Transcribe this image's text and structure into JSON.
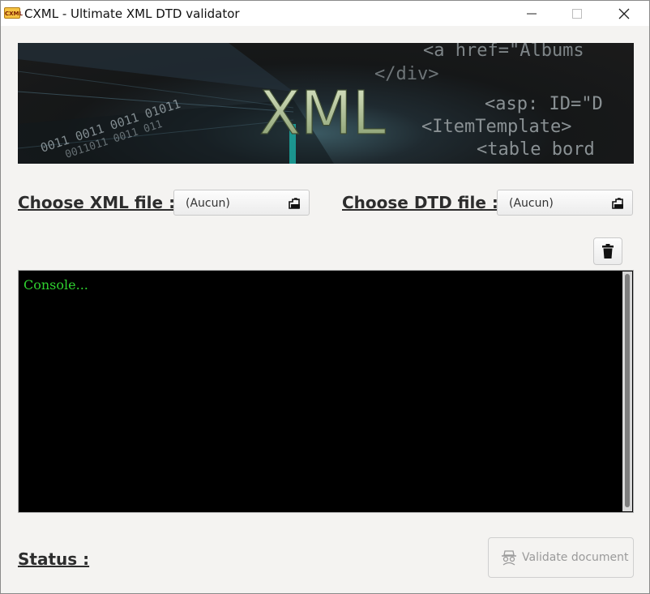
{
  "window": {
    "title": "CXML - Ultimate XML DTD validator",
    "app_icon_text": "CXML"
  },
  "banner": {
    "logo_text": "XML",
    "code_lines": [
      "<a href=\"Albums",
      "</div>",
      "<asp: ID=\"D",
      "<ItemTemplate>",
      "<table bord"
    ],
    "binary_lines": [
      "0011 0011 0011 01011",
      "0011011 0011 011"
    ]
  },
  "xml_picker": {
    "label": "Choose XML file :",
    "value": "(Aucun)"
  },
  "dtd_picker": {
    "label": "Choose DTD file :",
    "value": "(Aucun)"
  },
  "console": {
    "text": "Console..."
  },
  "status": {
    "label": "Status :"
  },
  "validate": {
    "label": "Validate document"
  },
  "colors": {
    "console_bg": "#000000",
    "console_text": "#2fd02f",
    "window_bg": "#f4f3f1"
  },
  "icons": [
    "minimize-icon",
    "maximize-icon",
    "close-icon",
    "folder-open-icon",
    "trash-icon",
    "spy-icon"
  ]
}
